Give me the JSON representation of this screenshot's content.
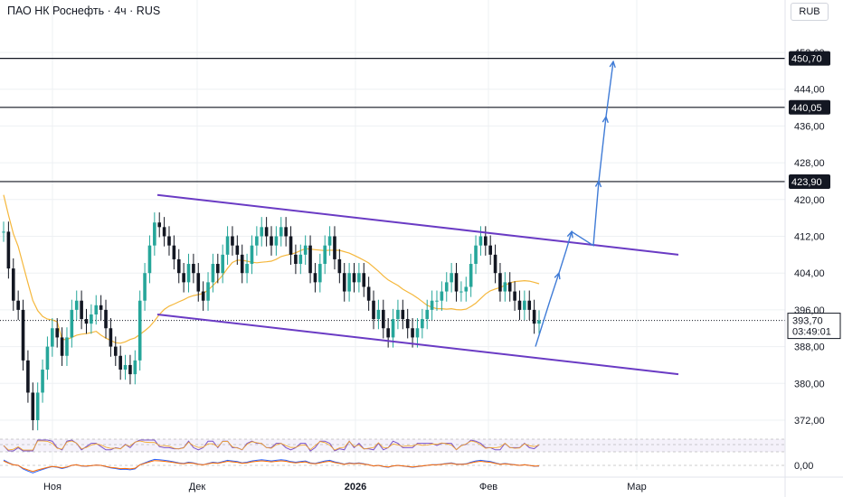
{
  "header": {
    "title": "ПАО НК Роснефть · 4ч · RUS",
    "currency": "RUB"
  },
  "colors": {
    "candle": "#26a69a",
    "candle_dark": "#131722",
    "ma": "#f5b73b",
    "channel": "#6a3bc4",
    "arrow": "#3f7bd6",
    "hline": "#131722",
    "grid": "#eef0f3"
  },
  "chart_data": {
    "type": "candlestick",
    "y_ticks": [
      "452,00",
      "444,00",
      "436,00",
      "428,00",
      "420,00",
      "412,00",
      "404,00",
      "396,00",
      "388,00",
      "380,00",
      "372,00"
    ],
    "y_tick_values": [
      452,
      444,
      436,
      428,
      420,
      412,
      404,
      396,
      388,
      380,
      372
    ],
    "x_ticks": [
      {
        "label": "Ноя",
        "bold": false
      },
      {
        "label": "Дек",
        "bold": false
      },
      {
        "label": "2026",
        "bold": true
      },
      {
        "label": "Фев",
        "bold": false
      },
      {
        "label": "Мар",
        "bold": false
      }
    ],
    "price_lines": [
      {
        "label": "450,70",
        "value": 450.7
      },
      {
        "label": "440,05",
        "value": 440.05
      },
      {
        "label": "423,90",
        "value": 423.9
      }
    ],
    "last_price": {
      "label": "393,70",
      "value": 393.7,
      "countdown": "03:49:01"
    },
    "indicator_tick": "0,00",
    "close_series": [
      413,
      405,
      398,
      396,
      385,
      378,
      372,
      378,
      383,
      388,
      392,
      390,
      386,
      390,
      396,
      398,
      394,
      393,
      395,
      397,
      396,
      392,
      388,
      386,
      383,
      384,
      382,
      385,
      398,
      404,
      410,
      415,
      414,
      412,
      410,
      407,
      404,
      402,
      406,
      404,
      400,
      398,
      402,
      406,
      404,
      408,
      412,
      410,
      408,
      404,
      406,
      410,
      412,
      414,
      412,
      410,
      412,
      414,
      412,
      408,
      406,
      408,
      410,
      404,
      402,
      406,
      410,
      412,
      407,
      404,
      400,
      404,
      402,
      404,
      401,
      398,
      394,
      396,
      392,
      390,
      394,
      396,
      394,
      392,
      390,
      392,
      394,
      396,
      398,
      398,
      400,
      402,
      404,
      400,
      400,
      401,
      406,
      410,
      412,
      410,
      408,
      404,
      400,
      402,
      400,
      398,
      396,
      398,
      396,
      393,
      393.7
    ],
    "ma_series_note": "moving average",
    "channel": {
      "upper": [
        [
          0,
          421
        ],
        [
          1,
          408
        ]
      ],
      "lower": [
        [
          0,
          395
        ],
        [
          1,
          382
        ]
      ]
    },
    "projection": [
      388,
      398,
      404,
      409,
      413,
      410,
      424,
      438,
      450
    ]
  }
}
